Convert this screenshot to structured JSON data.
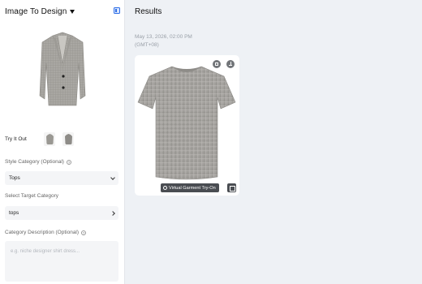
{
  "left_panel": {
    "title": "Image To Design",
    "try_it_out_label": "Try It Out",
    "style_category": {
      "label": "Style Category (Optional)",
      "value": "Tops"
    },
    "target_category": {
      "label": "Select Target Category",
      "value": "tops"
    },
    "category_description": {
      "label": "Category Description (Optional)",
      "placeholder": "e.g. niche designer shirt dress..."
    }
  },
  "main": {
    "title": "Results",
    "timestamp": "May 13, 2026, 02:00 PM (GMT+08)",
    "card": {
      "tryon_label": "Virtual Garment Try-On"
    }
  },
  "colors": {
    "accent": "#2e6ee6",
    "panel_bg": "#ffffff",
    "canvas_bg": "#eef1f5"
  },
  "icons": [
    "chevron-down-icon",
    "collapse-panel-icon",
    "info-icon",
    "chevron-right-icon",
    "save-icon",
    "download-icon",
    "hanger-icon",
    "compare-icon"
  ]
}
